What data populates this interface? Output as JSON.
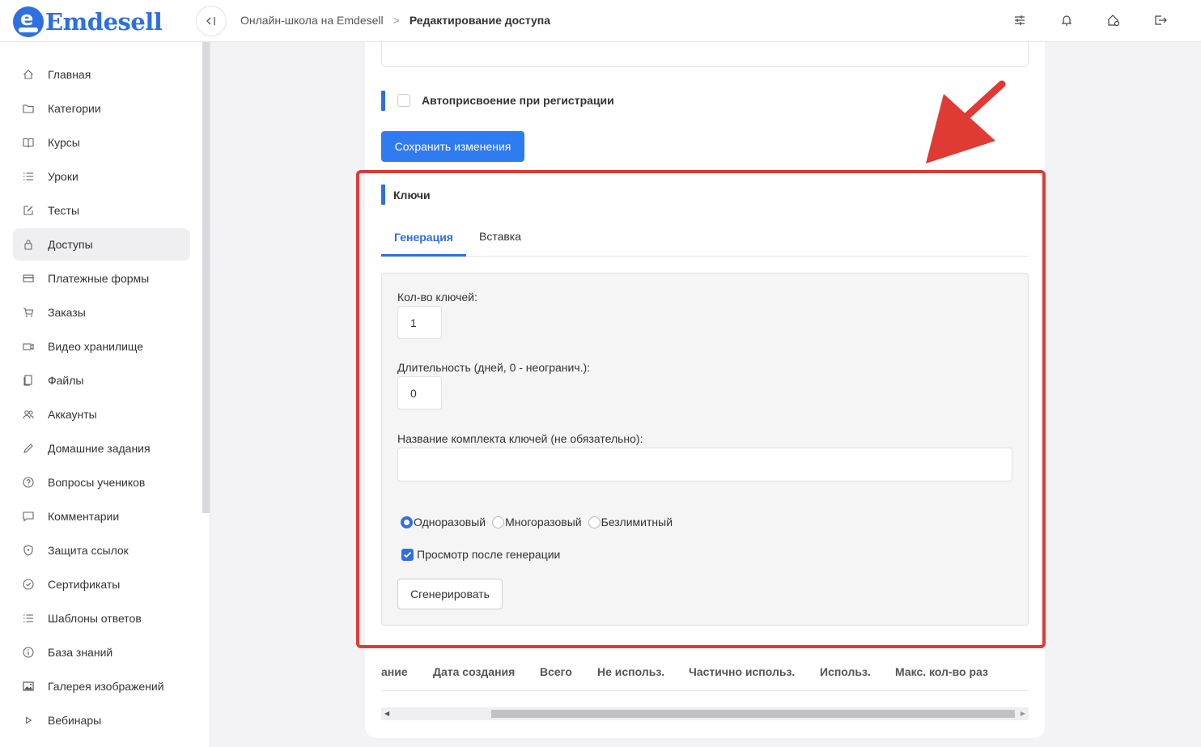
{
  "app": {
    "logo_text": "Emdesell",
    "logo_letter": "e"
  },
  "breadcrumb": {
    "parent": "Онлайн-школа на Emdesell",
    "separator": ">",
    "current": "Редактирование доступа"
  },
  "topbar_icons": [
    "sliders-icon",
    "bell-icon",
    "home-settings-icon",
    "logout-icon"
  ],
  "sidebar": {
    "items": [
      {
        "label": "Главная",
        "icon": "home-icon"
      },
      {
        "label": "Категории",
        "icon": "folder-icon"
      },
      {
        "label": "Курсы",
        "icon": "book-icon"
      },
      {
        "label": "Уроки",
        "icon": "list-icon"
      },
      {
        "label": "Тесты",
        "icon": "edit-icon"
      },
      {
        "label": "Доступы",
        "icon": "lock-icon",
        "active": true
      },
      {
        "label": "Платежные формы",
        "icon": "credit-card-icon"
      },
      {
        "label": "Заказы",
        "icon": "cart-icon"
      },
      {
        "label": "Видео хранилище",
        "icon": "video-icon"
      },
      {
        "label": "Файлы",
        "icon": "files-icon"
      },
      {
        "label": "Аккаунты",
        "icon": "users-icon"
      },
      {
        "label": "Домашние задания",
        "icon": "pencil-icon"
      },
      {
        "label": "Вопросы учеников",
        "icon": "question-icon"
      },
      {
        "label": "Комментарии",
        "icon": "comment-icon"
      },
      {
        "label": "Защита ссылок",
        "icon": "shield-icon"
      },
      {
        "label": "Сертификаты",
        "icon": "check-circle-icon"
      },
      {
        "label": "Шаблоны ответов",
        "icon": "list-icon"
      },
      {
        "label": "База знаний",
        "icon": "info-icon"
      },
      {
        "label": "Галерея изображений",
        "icon": "image-icon"
      },
      {
        "label": "Вебинары",
        "icon": "play-icon"
      }
    ]
  },
  "main": {
    "auto_assign_label": "Автоприсвоение при регистрации",
    "auto_assign_checked": false,
    "save_button": "Сохранить изменения",
    "keys_title": "Ключи",
    "tabs": [
      {
        "label": "Генерация",
        "active": true
      },
      {
        "label": "Вставка",
        "active": false
      }
    ],
    "generation": {
      "count_label": "Кол-во ключей:",
      "count_value": "1",
      "duration_label": "Длительность (дней, 0 - неогранич.):",
      "duration_value": "0",
      "set_name_label": "Название комплекта ключей (не обязательно):",
      "set_name_value": "",
      "usage_options": [
        {
          "label": "Одноразовый",
          "selected": true
        },
        {
          "label": "Многоразовый",
          "selected": false
        },
        {
          "label": "Безлимитный",
          "selected": false
        }
      ],
      "preview_label": "Просмотр после генерации",
      "preview_checked": true,
      "generate_button": "Сгенерировать"
    },
    "table": {
      "columns": [
        "ание",
        "Дата создания",
        "Всего",
        "Не использ.",
        "Частично использ.",
        "Использ.",
        "Макс. кол-во раз"
      ]
    }
  },
  "colors": {
    "accent": "#2f6fe0",
    "annotation_red": "#e03a35",
    "button_primary": "#2f7bf0"
  }
}
